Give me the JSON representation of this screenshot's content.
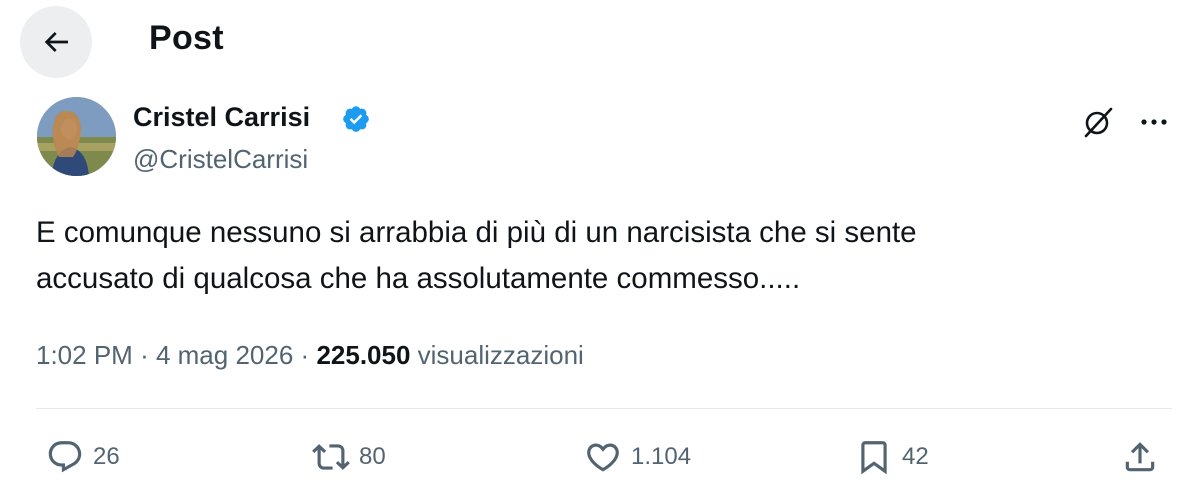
{
  "header": {
    "title": "Post"
  },
  "author": {
    "name": "Cristel Carrisi",
    "handle": "@CristelCarrisi",
    "verified_color": "#1d9bf0"
  },
  "post": {
    "text_lines": [
      "E comunque nessuno si arrabbia di più di un narcisista che si sente",
      "accusato di qualcosa che ha assolutamente commesso....."
    ],
    "time": "1:02 PM",
    "separator": "·",
    "date": "4 mag 2026",
    "views_count": "225.050",
    "views_label": "visualizzazioni"
  },
  "actions": {
    "replies": "26",
    "reposts": "80",
    "likes": "1.104",
    "bookmarks": "42"
  },
  "icons": [
    "back-arrow-icon",
    "verified-badge-icon",
    "grok-icon",
    "more-icon",
    "reply-icon",
    "retweet-icon",
    "heart-icon",
    "bookmark-icon",
    "share-icon"
  ]
}
